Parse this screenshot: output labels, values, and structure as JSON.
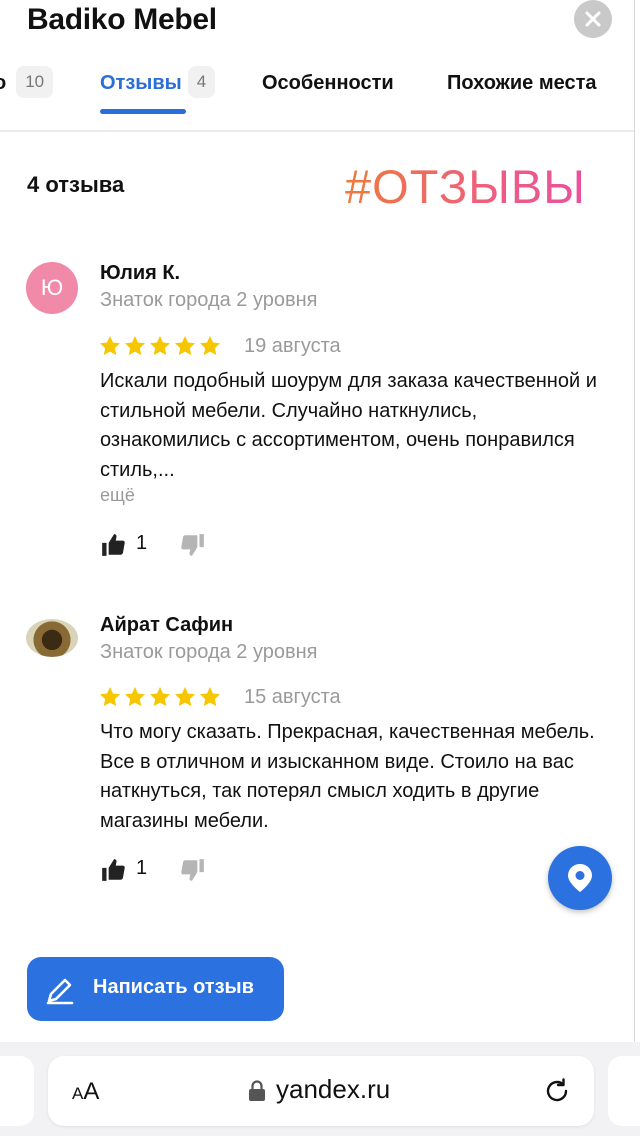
{
  "header": {
    "title": "Badiko Mebel",
    "close_icon": "close-icon"
  },
  "tabs": [
    {
      "label": "о",
      "count": "10"
    },
    {
      "label": "Отзывы",
      "count": "4",
      "active": true
    },
    {
      "label": "Особенности"
    },
    {
      "label": "Похожие места"
    }
  ],
  "reviews_section": {
    "count_label": "4 отзыва",
    "hashtag": "#ОТЗЫВЫ",
    "hashtag_colors": [
      "#ef7a3c",
      "#e9509d"
    ]
  },
  "reviews": [
    {
      "avatar_letter": "Ю",
      "avatar_color": "#f08aa8",
      "name": "Юлия К.",
      "level": "Знаток города 2 уровня",
      "rating": 5,
      "date": "19 августа",
      "text": "Искали подобный шоурум для заказа качественной и стильной мебели. Случайно наткнулись, ознакомились с ассортиментом, очень понравился стиль,...",
      "more_label": "ещё",
      "likes": "1"
    },
    {
      "avatar_letter": "",
      "name": "Айрат Сафин",
      "level": "Знаток города 2 уровня",
      "rating": 5,
      "date": "15 августа",
      "text": "Что могу сказать. Прекрасная, качественная мебель. Все в отличном и изысканном виде. Стоило на вас наткнуться, так потерял смысл ходить в другие магазины мебели.",
      "likes": "1"
    }
  ],
  "actions": {
    "write_review_label": "Написать отзыв",
    "accent_color": "#2b71df",
    "star_color": "#f6c700"
  },
  "browser": {
    "text_size_label": "AA",
    "url": "yandex.ru"
  }
}
